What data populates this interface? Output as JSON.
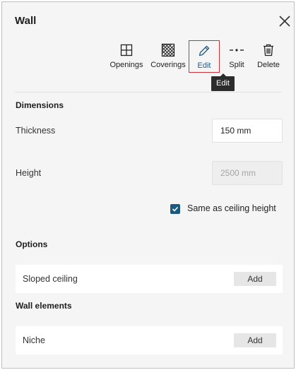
{
  "panel": {
    "title": "Wall",
    "close_icon": "close-icon"
  },
  "toolbar": {
    "items": [
      {
        "label": "Openings",
        "icon": "window-grid-icon",
        "active": false
      },
      {
        "label": "Coverings",
        "icon": "hatch-pattern-icon",
        "active": false
      },
      {
        "label": "Edit",
        "icon": "pencil-icon",
        "active": true
      },
      {
        "label": "Split",
        "icon": "split-line-icon",
        "active": false
      },
      {
        "label": "Delete",
        "icon": "trash-icon",
        "active": false
      }
    ],
    "tooltip": "Edit"
  },
  "dimensions": {
    "title": "Dimensions",
    "thickness_label": "Thickness",
    "thickness_value": "150 mm",
    "height_label": "Height",
    "height_value": "2500 mm",
    "height_disabled": true,
    "same_as_ceiling_label": "Same as ceiling height",
    "same_as_ceiling_checked": true
  },
  "options": {
    "title": "Options",
    "rows": [
      {
        "label": "Sloped ceiling",
        "button": "Add"
      }
    ]
  },
  "wall_elements": {
    "title": "Wall elements",
    "rows": [
      {
        "label": "Niche",
        "button": "Add"
      }
    ]
  },
  "colors": {
    "accent": "#1a5a80",
    "active_border": "#d0323c",
    "panel_bg": "#f5f5f5"
  }
}
